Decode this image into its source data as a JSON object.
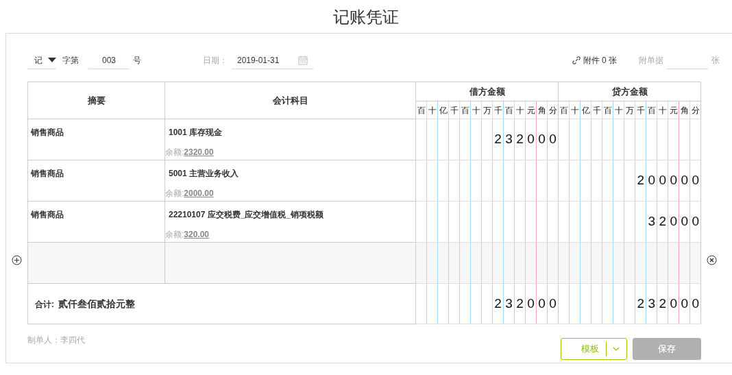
{
  "title": "记账凭证",
  "header": {
    "voucher_word": "记",
    "word_label": "字第",
    "number": "003",
    "number_suffix": "号",
    "date_label": "日期：",
    "date": "2019-01-31",
    "attachments": "附件 0 张",
    "receipts_label": "附单据",
    "receipts_unit": "张"
  },
  "table": {
    "columns": [
      "摘要",
      "会计科目",
      "借方金额",
      "贷方金额"
    ],
    "debit_units": [
      "百",
      "十",
      "亿",
      "千",
      "百",
      "十",
      "万",
      "千",
      "百",
      "十",
      "元",
      "角",
      "分"
    ],
    "credit_units": [
      "百",
      "十",
      "亿",
      "千",
      "百",
      "十",
      "万",
      "千",
      "百",
      "十",
      "元",
      "角",
      "分"
    ],
    "rows": [
      {
        "summary": "销售商品",
        "account": "1001 库存现金",
        "balance_label": "余额:",
        "balance": "2320.00",
        "debit": "232000"
      },
      {
        "summary": "销售商品",
        "account": "5001 主营业务收入",
        "balance_label": "余额:",
        "balance": "2000.00",
        "credit": "200000"
      },
      {
        "summary": "销售商品",
        "account": "22210107 应交税费_应交增值税_销项税额",
        "balance_label": "余额:",
        "balance": "320.00",
        "credit": "32000"
      }
    ],
    "total": {
      "label": "合计:",
      "words": "贰仟叁佰贰拾元整",
      "debit": "232000",
      "credit": "232000"
    }
  },
  "footer": {
    "maker": "制单人：李四代",
    "template_button": "模板",
    "save_button": "保存",
    "save_disabled": true
  }
}
